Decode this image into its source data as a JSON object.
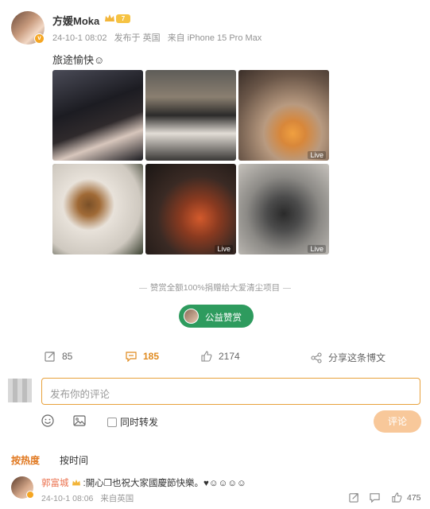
{
  "post": {
    "username": "方媛Moka",
    "level": "7",
    "date": "24-10-1 08:02",
    "location": "发布于 英国",
    "device": "来自 iPhone 15 Pro Max",
    "text": "旅途愉快☺",
    "live_label": "Live"
  },
  "charity": {
    "banner": "赞赏全额100%捐赠给大爱清尘项目",
    "button_label": "公益赞赏"
  },
  "actions": {
    "repost_count": "85",
    "comment_count": "185",
    "like_count": "2174",
    "share_label": "分享这条博文"
  },
  "composer": {
    "placeholder": "发布你的评论",
    "repost_label": "同时转发",
    "submit_label": "评论"
  },
  "sort": {
    "hot": "按热度",
    "time": "按时间"
  },
  "comment": {
    "author": "郭富城",
    "text": ":開心❒也祝大家國慶節快樂。♥☺☺☺☺",
    "date": "24-10-1 08:06",
    "source": "来自英国",
    "like_count": "475"
  },
  "colors": {
    "accent": "#e0771e",
    "charity_green": "#2e9b5e",
    "username_orange": "#eb7350"
  }
}
